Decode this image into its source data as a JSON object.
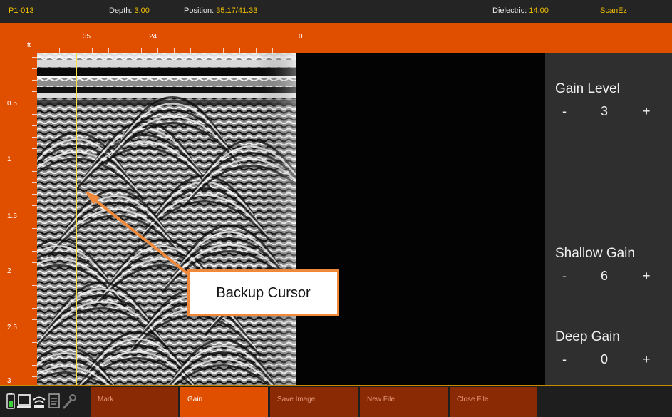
{
  "status_bar": {
    "file": "P1-013",
    "depth_label": "Depth:",
    "depth_value": "3.00",
    "position_label": "Position:",
    "position_value": "35.17/41.33",
    "dielectric_label": "Dielectric:",
    "dielectric_value": "14.00",
    "brand": "ScanEz"
  },
  "horizontal_ruler": {
    "unit": "ft",
    "labels": [
      "35",
      "24",
      "0"
    ]
  },
  "vertical_ruler": {
    "labels": [
      "0.5",
      "1",
      "1.5",
      "2",
      "2.5",
      "3"
    ]
  },
  "gain_panel": {
    "minus_symbol": "-",
    "plus_symbol": "+",
    "gain_level": {
      "title": "Gain Level",
      "value": "3"
    },
    "shallow_gain": {
      "title": "Shallow Gain",
      "value": "6"
    },
    "deep_gain": {
      "title": "Deep Gain",
      "value": "0"
    }
  },
  "toolbar": {
    "buttons": [
      "Mark",
      "Gain",
      "Save Image",
      "New File",
      "Close File"
    ],
    "active": "Gain"
  },
  "status_icons": [
    "battery-icon",
    "screen-icon",
    "wifi-icon",
    "document-icon",
    "wrench-icon"
  ],
  "callout": {
    "text": "Backup Cursor"
  },
  "colors": {
    "accent_orange": "#e04e00",
    "value_yellow": "#f2c200",
    "cursor_yellow": "#ffe04a",
    "callout_border": "#f08a3a"
  }
}
